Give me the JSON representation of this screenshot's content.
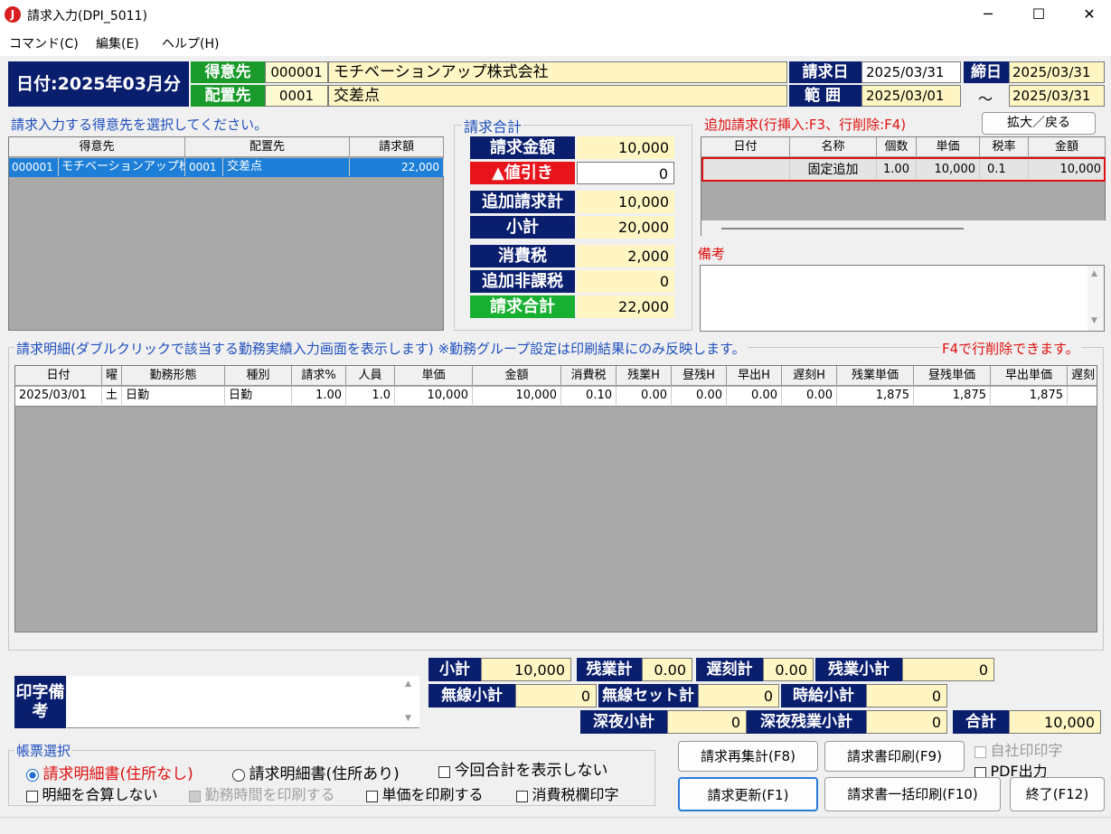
{
  "window": {
    "title": "請求入力(DPI_5011)",
    "minimize": "─",
    "maximize": "☐",
    "close": "✕"
  },
  "menu": [
    "コマンド(C)",
    "編集(E)",
    "ヘルプ(H)"
  ],
  "header": {
    "date": "日付:2025年03月分",
    "customer_label": "得意先",
    "customer_code": "000001",
    "customer_name": "モチベーションアップ株式会社",
    "site_label": "配置先",
    "site_code": "0001",
    "site_name": "交差点",
    "billdate_label": "請求日",
    "billdate": "2025/03/31",
    "close_label": "締日",
    "closedate": "2025/03/31",
    "range_label": "範囲",
    "range_from": "2025/03/01",
    "range_sep": "～",
    "range_to": "2025/03/31"
  },
  "customer_list": {
    "caption": "請求入力する得意先を選択してください。",
    "columns": [
      "得意先",
      "配置先",
      "請求額"
    ],
    "rows": [
      {
        "code": "000001",
        "name": "モチベーションアップ株",
        "site_code": "0001",
        "site": "交差点",
        "amount": "22,000"
      }
    ]
  },
  "summary": {
    "caption": "請求合計",
    "items": [
      {
        "label": "請求金額",
        "value": "10,000"
      },
      {
        "label": "▲値引き",
        "value": "0"
      },
      {
        "label": "追加請求計",
        "value": "10,000"
      },
      {
        "label": "小計",
        "value": "20,000"
      },
      {
        "label": "消費税",
        "value": "2,000"
      },
      {
        "label": "追加非課税",
        "value": "0"
      },
      {
        "label": "請求合計",
        "value": "22,000"
      }
    ]
  },
  "additional": {
    "caption": "追加請求(行挿入:F3、行削除:F4)",
    "expand_button": "拡大／戻る",
    "columns": [
      "日付",
      "名称",
      "個数",
      "単価",
      "税率",
      "金額"
    ],
    "rows": [
      {
        "date": "",
        "name": "固定追加",
        "qty": "1.00",
        "price": "10,000",
        "tax": "0.1",
        "amount": "10,000"
      }
    ]
  },
  "remarks_label": "備考",
  "detail": {
    "caption": "請求明細(ダブルクリックで該当する勤務実績入力画面を表示します) ※勤務グループ設定は印刷結果にのみ反映します。",
    "delete_hint": "F4で行削除できます。",
    "columns": [
      "日付",
      "曜",
      "勤務形態",
      "種別",
      "請求%",
      "人員",
      "単価",
      "金額",
      "消費税",
      "残業H",
      "昼残H",
      "早出H",
      "遅刻H",
      "残業単価",
      "昼残単価",
      "早出単価",
      "遅刻"
    ],
    "rows": [
      [
        "2025/03/01",
        "土",
        "日勤",
        "日勤",
        "1.00",
        "1.0",
        "10,000",
        "10,000",
        "0.10",
        "0.00",
        "0.00",
        "0.00",
        "0.00",
        "1,875",
        "1,875",
        "1,875",
        ""
      ]
    ]
  },
  "print_remarks_label": "印字備考",
  "totals": {
    "subtotal_label": "小計",
    "subtotal": "10,000",
    "overtime_label": "残業計",
    "overtime": "0.00",
    "late_label": "遅刻計",
    "late": "0.00",
    "overtime_sub_label": "残業小計",
    "overtime_sub": "0",
    "wireless_label": "無線小計",
    "wireless": "0",
    "wireless_set_label": "無線セット計",
    "wireless_set": "0",
    "hourly_label": "時給小計",
    "hourly": "0",
    "night_label": "深夜小計",
    "night": "0",
    "night_ot_label": "深夜残業小計",
    "night_ot": "0",
    "total_label": "合計",
    "total": "10,000"
  },
  "form_select": {
    "caption": "帳票選択",
    "radio1": "請求明細書(住所なし)",
    "radio2": "請求明細書(住所あり)",
    "chk_total": "今回合計を表示しない",
    "chk_merge": "明細を合算しない",
    "chk_worktime": "勤務時間を印刷する",
    "chk_unitprice": "単価を印刷する",
    "chk_taxcol": "消費税欄印字"
  },
  "buttons": {
    "recalc": "請求再集計(F8)",
    "print": "請求書印刷(F9)",
    "company_stamp": "自社印印字",
    "pdf": "PDF出力",
    "update": "請求更新(F1)",
    "batch_print": "請求書一括印刷(F10)",
    "exit": "終了(F12)"
  },
  "colors": {
    "navy": "#0a1e6e",
    "green": "#1a9a2a",
    "red": "#e8141c",
    "highlight": "#1e7fd8"
  }
}
